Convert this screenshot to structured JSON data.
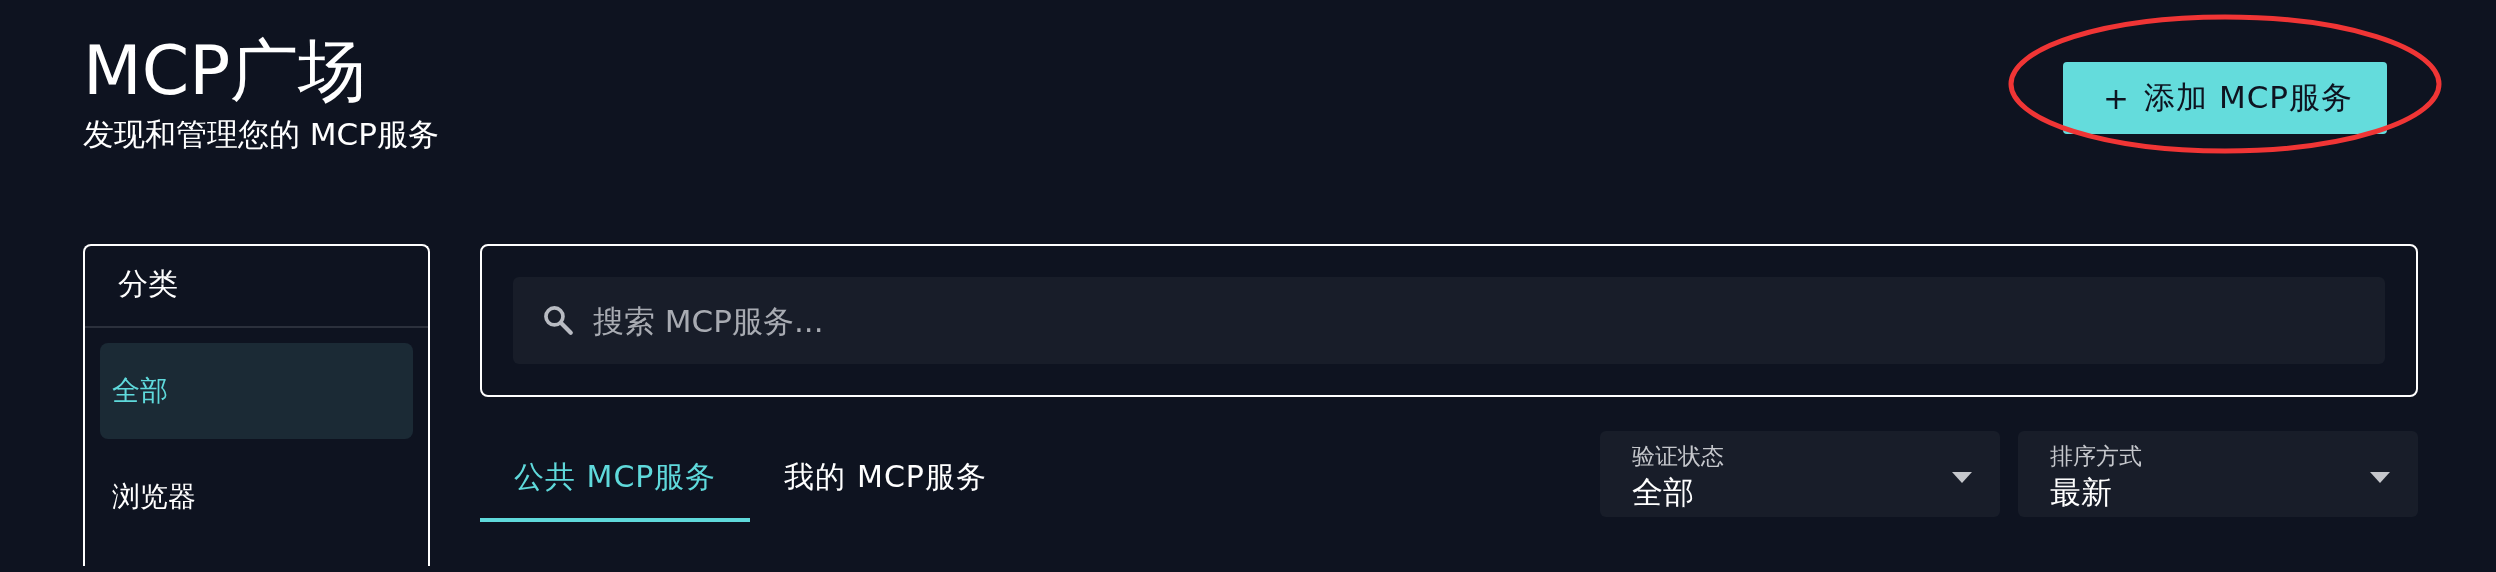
{
  "header": {
    "title": "MCP广场",
    "subtitle": "发现和管理您的 MCP服务",
    "add_button": {
      "icon": "+",
      "label": "添加 MCP服务",
      "highlighted": true
    }
  },
  "sidebar": {
    "title": "分类",
    "items": [
      {
        "label": "全部",
        "selected": true
      },
      {
        "label": "浏览器",
        "selected": false
      }
    ]
  },
  "search": {
    "placeholder": "搜索 MCP服务..."
  },
  "tabs": [
    {
      "label": "公共 MCP服务",
      "selected": true
    },
    {
      "label": "我的 MCP服务",
      "selected": false
    }
  ],
  "filters": [
    {
      "label": "验证状态",
      "value": "全部"
    },
    {
      "label": "排序方式",
      "value": "最新"
    }
  ]
}
